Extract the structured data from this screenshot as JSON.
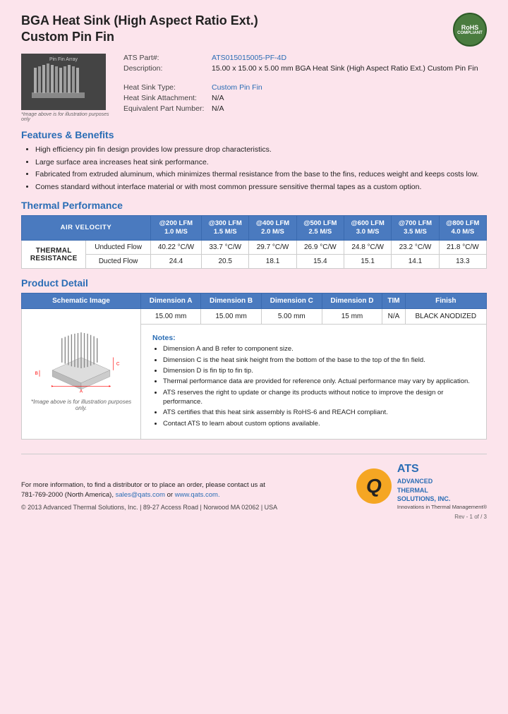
{
  "header": {
    "title_line1": "BGA Heat Sink (High Aspect Ratio Ext.)",
    "title_line2": "Custom Pin Fin",
    "rohs": "RoHS",
    "compliant": "COMPLIANT"
  },
  "part_info": {
    "ats_part_label": "ATS Part#:",
    "ats_part_value": "ATS015015005-PF-4D",
    "description_label": "Description:",
    "description_value": "15.00 x 15.00 x 5.00 mm  BGA Heat Sink (High Aspect Ratio Ext.) Custom Pin Fin",
    "heat_sink_type_label": "Heat Sink Type:",
    "heat_sink_type_value": "Custom Pin Fin",
    "heat_sink_attachment_label": "Heat Sink Attachment:",
    "heat_sink_attachment_value": "N/A",
    "equivalent_part_label": "Equivalent Part Number:",
    "equivalent_part_value": "N/A"
  },
  "image_caption": "*Image above is for illustration purposes only",
  "features": {
    "title": "Features & Benefits",
    "items": [
      "High efficiency pin fin design provides low pressure drop characteristics.",
      "Large surface area increases heat sink performance.",
      "Fabricated from extruded aluminum, which minimizes thermal resistance from the base to the fins, reduces weight and keeps costs low.",
      "Comes standard without interface material or with most common pressure sensitive thermal tapes as a custom option."
    ]
  },
  "thermal_performance": {
    "title": "Thermal Performance",
    "air_velocity_label": "AIR VELOCITY",
    "columns": [
      {
        "label": "@200 LFM\n1.0 M/S"
      },
      {
        "label": "@300 LFM\n1.5 M/S"
      },
      {
        "label": "@400 LFM\n2.0 M/S"
      },
      {
        "label": "@500 LFM\n2.5 M/S"
      },
      {
        "label": "@600 LFM\n3.0 M/S"
      },
      {
        "label": "@700 LFM\n3.5 M/S"
      },
      {
        "label": "@800 LFM\n4.0 M/S"
      }
    ],
    "thermal_resistance_label": "THERMAL RESISTANCE",
    "rows": [
      {
        "sub_label": "Unducted Flow",
        "values": [
          "40.22 °C/W",
          "33.7 °C/W",
          "29.7 °C/W",
          "26.9 °C/W",
          "24.8 °C/W",
          "23.2 °C/W",
          "21.8 °C/W"
        ]
      },
      {
        "sub_label": "Ducted Flow",
        "values": [
          "24.4",
          "20.5",
          "18.1",
          "15.4",
          "15.1",
          "14.1",
          "13.3"
        ]
      }
    ]
  },
  "product_detail": {
    "title": "Product Detail",
    "columns": [
      "Schematic Image",
      "Dimension A",
      "Dimension B",
      "Dimension C",
      "Dimension D",
      "TIM",
      "Finish"
    ],
    "dim_a": "15.00 mm",
    "dim_b": "15.00 mm",
    "dim_c": "5.00 mm",
    "dim_d": "15 mm",
    "tim": "N/A",
    "finish": "BLACK ANODIZED",
    "schematic_caption": "*Image above is for illustration purposes only.",
    "notes_title": "Notes:",
    "notes": [
      "Dimension A and B refer to component size.",
      "Dimension C is the heat sink height from the bottom of the base to the top of the fin field.",
      "Dimension D is fin tip to fin tip.",
      "Thermal performance data are provided for reference only. Actual performance may vary by application.",
      "ATS reserves the right to update or change its products without notice to improve the design or performance.",
      "ATS certifies that this heat sink assembly is RoHS-6 and REACH compliant.",
      "Contact ATS to learn about custom options available."
    ]
  },
  "footer": {
    "contact_text": "For more information, to find a distributor or to place an order, please contact us at",
    "phone": "781-769-2000 (North America),",
    "email": "sales@qats.com",
    "or": "or",
    "website": "www.qats.com.",
    "copyright": "© 2013 Advanced Thermal Solutions, Inc. | 89-27 Access Road | Norwood MA  02062 | USA",
    "page_num": "Rev - 1 of / 3",
    "ats_q": "Q",
    "ats_company": "ATS",
    "ats_full1": "ADVANCED",
    "ats_full2": "THERMAL",
    "ats_full3": "SOLUTIONS, INC.",
    "ats_tagline": "Innovations in Thermal Management®"
  }
}
